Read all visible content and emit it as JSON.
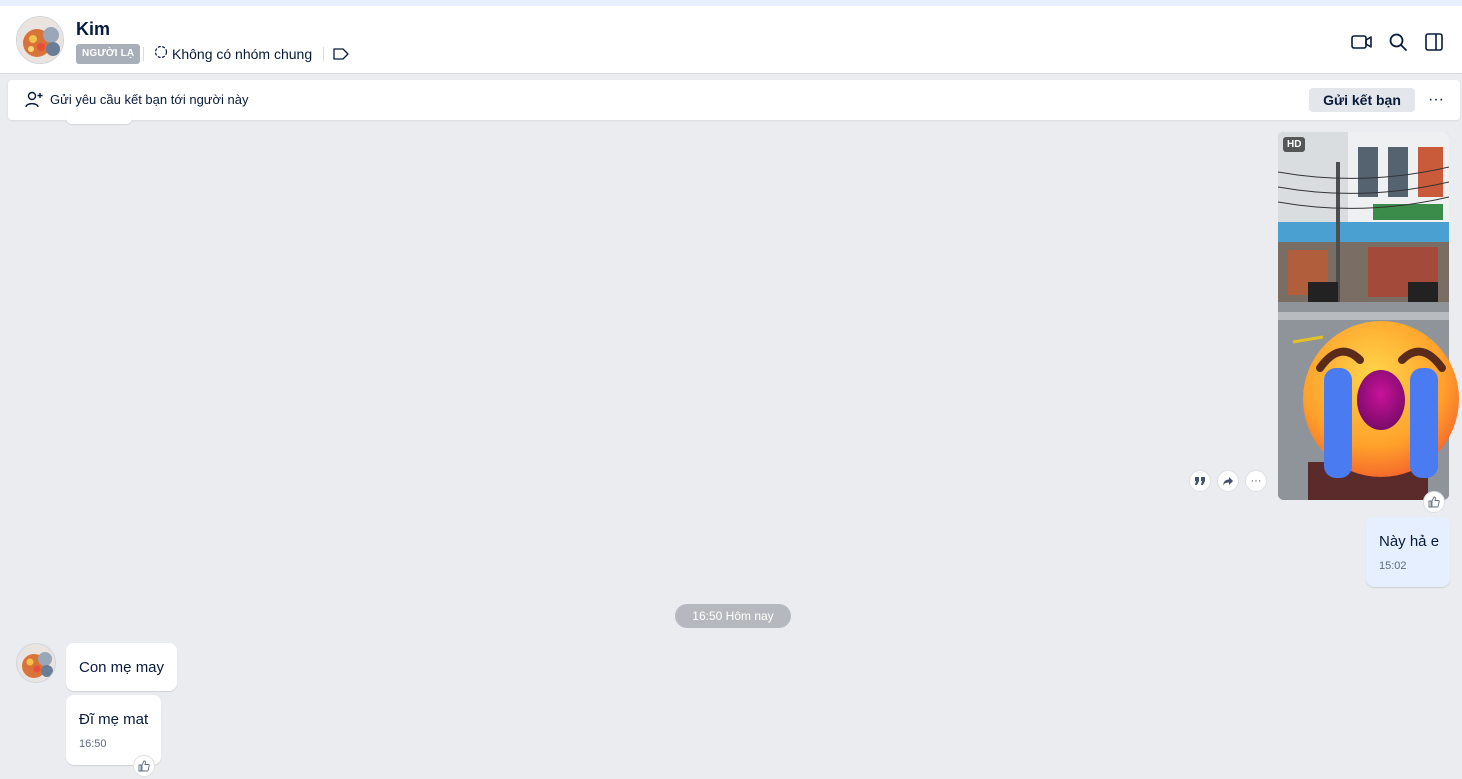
{
  "header": {
    "name": "Kim",
    "badge": "NGƯỜI LẠ",
    "group_text": "Không có nhóm chung",
    "icons": [
      "video-call-icon",
      "search-icon",
      "sidebar-toggle-icon"
    ]
  },
  "friend_bar": {
    "text": "Gửi yêu cầu kết bạn tới người này",
    "button_label": "Gửi kết bạn",
    "more_label": "···"
  },
  "photo_message": {
    "badge": "HD",
    "actions": [
      "quote-icon",
      "forward-icon",
      "more-icon"
    ],
    "more_label": "···"
  },
  "sent_message": {
    "text": "Này hả e",
    "time": "15:02"
  },
  "date_separator": "16:50 Hôm nay",
  "received_messages": [
    {
      "text": "Con mẹ may",
      "time": ""
    },
    {
      "text": "Đĩ mẹ mat",
      "time": "16:50"
    }
  ],
  "colors": {
    "background": "#ebecf0",
    "sent_bubble": "#e5efff",
    "received_bubble": "#ffffff",
    "text": "#081b3a",
    "badge": "#a9afb8"
  }
}
